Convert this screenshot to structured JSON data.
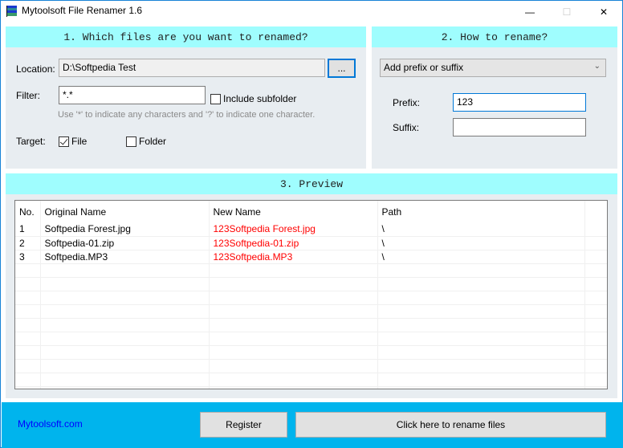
{
  "window": {
    "title": "Mytoolsoft File Renamer 1.6",
    "icon": "app-stack-icon",
    "controls": {
      "minimize": "—",
      "maximize": "☐",
      "close": "✕"
    }
  },
  "section1": {
    "header": "1. Which files are you want to renamed?",
    "location_label": "Location:",
    "location_value": "D:\\Softpedia Test",
    "browse_label": "...",
    "filter_label": "Filter:",
    "filter_value": "*.*",
    "include_subfolder_label": "Include subfolder",
    "include_subfolder_checked": false,
    "hint": "Use '*' to indicate any characters and '?' to indicate one character.",
    "target_label": "Target:",
    "target_file_label": "File",
    "target_file_checked": true,
    "target_folder_label": "Folder",
    "target_folder_checked": false
  },
  "section2": {
    "header": "2. How to rename?",
    "mode_selected": "Add prefix or suffix",
    "prefix_label": "Prefix:",
    "prefix_value": "123",
    "suffix_label": "Suffix:",
    "suffix_value": ""
  },
  "section3": {
    "header": "3. Preview",
    "columns": [
      "No.",
      "Original Name",
      "New Name",
      "Path"
    ],
    "rows": [
      {
        "no": "1",
        "original": "Softpedia Forest.jpg",
        "new": "123Softpedia Forest.jpg",
        "path": "\\"
      },
      {
        "no": "2",
        "original": "Softpedia-01.zip",
        "new": "123Softpedia-01.zip",
        "path": "\\"
      },
      {
        "no": "3",
        "original": "Softpedia.MP3",
        "new": "123Softpedia.MP3",
        "path": "\\"
      }
    ],
    "new_name_color": "#ff0000"
  },
  "footer": {
    "link": "Mytoolsoft.com",
    "register_label": "Register",
    "rename_label": "Click here to rename files"
  }
}
